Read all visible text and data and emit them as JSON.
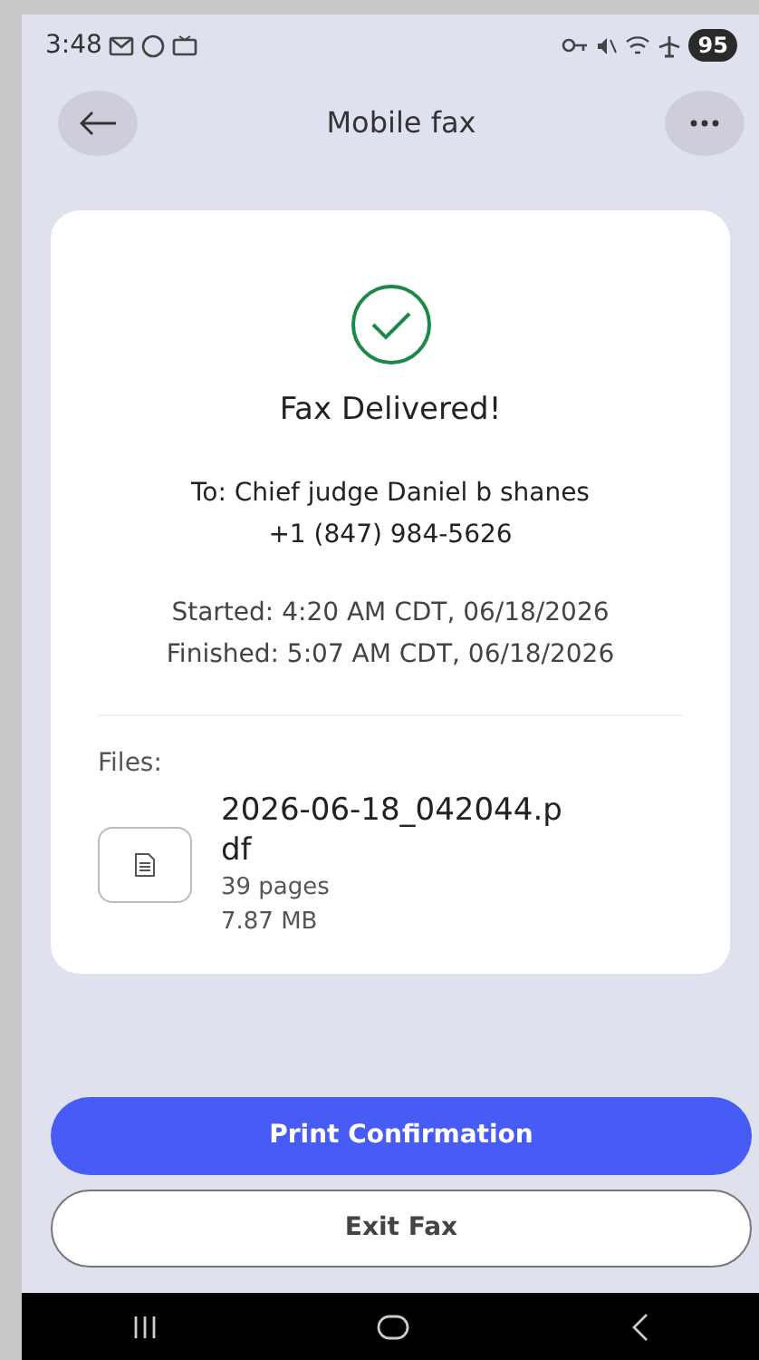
{
  "status_bar": {
    "time": "3:48",
    "battery": "95"
  },
  "header": {
    "title": "Mobile fax"
  },
  "result": {
    "title": "Fax Delivered!",
    "recipient": "To: Chief judge Daniel b shanes",
    "number": "+1 (847) 984-5626",
    "started": "Started: 4:20 AM CDT, 06/18/2026",
    "finished": "Finished: 5:07 AM CDT, 06/18/2026"
  },
  "files": {
    "label": "Files:",
    "items": [
      {
        "name": "2026-06-18_042044.pdf",
        "pages": "39 pages",
        "size": "7.87 MB"
      }
    ]
  },
  "buttons": [
    {
      "label": "Print Confirmation",
      "kind": "primary"
    },
    {
      "label": "Exit Fax",
      "kind": "outline"
    }
  ]
}
